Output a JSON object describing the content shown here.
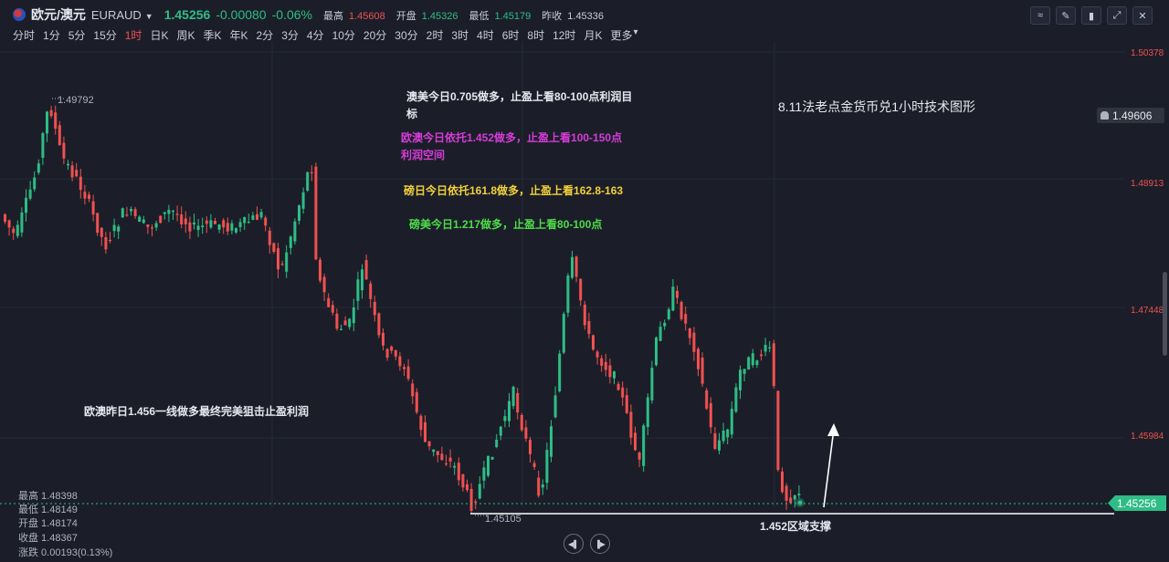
{
  "header": {
    "symbol_name": "欧元/澳元",
    "symbol_code": "EURAUD",
    "price": "1.45256",
    "change": "-0.00080",
    "change_pct": "-0.06%",
    "high_label": "最高",
    "high_value": "1.45608",
    "open_label": "开盘",
    "open_value": "1.45326",
    "low_label": "最低",
    "low_value": "1.45179",
    "prev_label": "昨收",
    "prev_value": "1.45336"
  },
  "periods": [
    "分时",
    "1分",
    "5分",
    "15分",
    "1时",
    "日K",
    "周K",
    "季K",
    "年K",
    "2分",
    "3分",
    "4分",
    "10分",
    "20分",
    "30分",
    "2时",
    "3时",
    "4时",
    "6时",
    "8时",
    "12时",
    "月K",
    "更多"
  ],
  "active_period": "1时",
  "axis": {
    "labels": [
      "1.50378",
      "1.48913",
      "1.47448",
      "1.45984"
    ],
    "bell_price": "1.49606",
    "current_price": "1.45256"
  },
  "chart_data": {
    "type": "candlestick",
    "high_marker": "1.49792",
    "low_marker": "1.45105",
    "support_label": "1.452区域支撑"
  },
  "annotations": {
    "title": "8.11法老点金货币兑1小时技术图形",
    "audusd_line1": "澳美今日0.705做多，止盈上看80-100点利润目",
    "audusd_line2": "标",
    "euraud_line1": "欧澳今日依托1.452做多，止盈上看100-150点",
    "euraud_line2": "利润空间",
    "gbpjpy": "磅日今日依托161.8做多，止盈上看162.8-163",
    "gbpusd": "磅美今日1.217做多，止盈上看80-100点",
    "yesterday": "欧澳昨日1.456一线做多最终完美狙击止盈利润"
  },
  "ohlc": {
    "high": "最高 1.48398",
    "low": "最低 1.48149",
    "open": "开盘 1.48174",
    "close": "收盘 1.48367",
    "change": "涨跌 0.00193(0.13%)"
  },
  "colors": {
    "up": "#2ebd85",
    "down": "#f0514f"
  }
}
